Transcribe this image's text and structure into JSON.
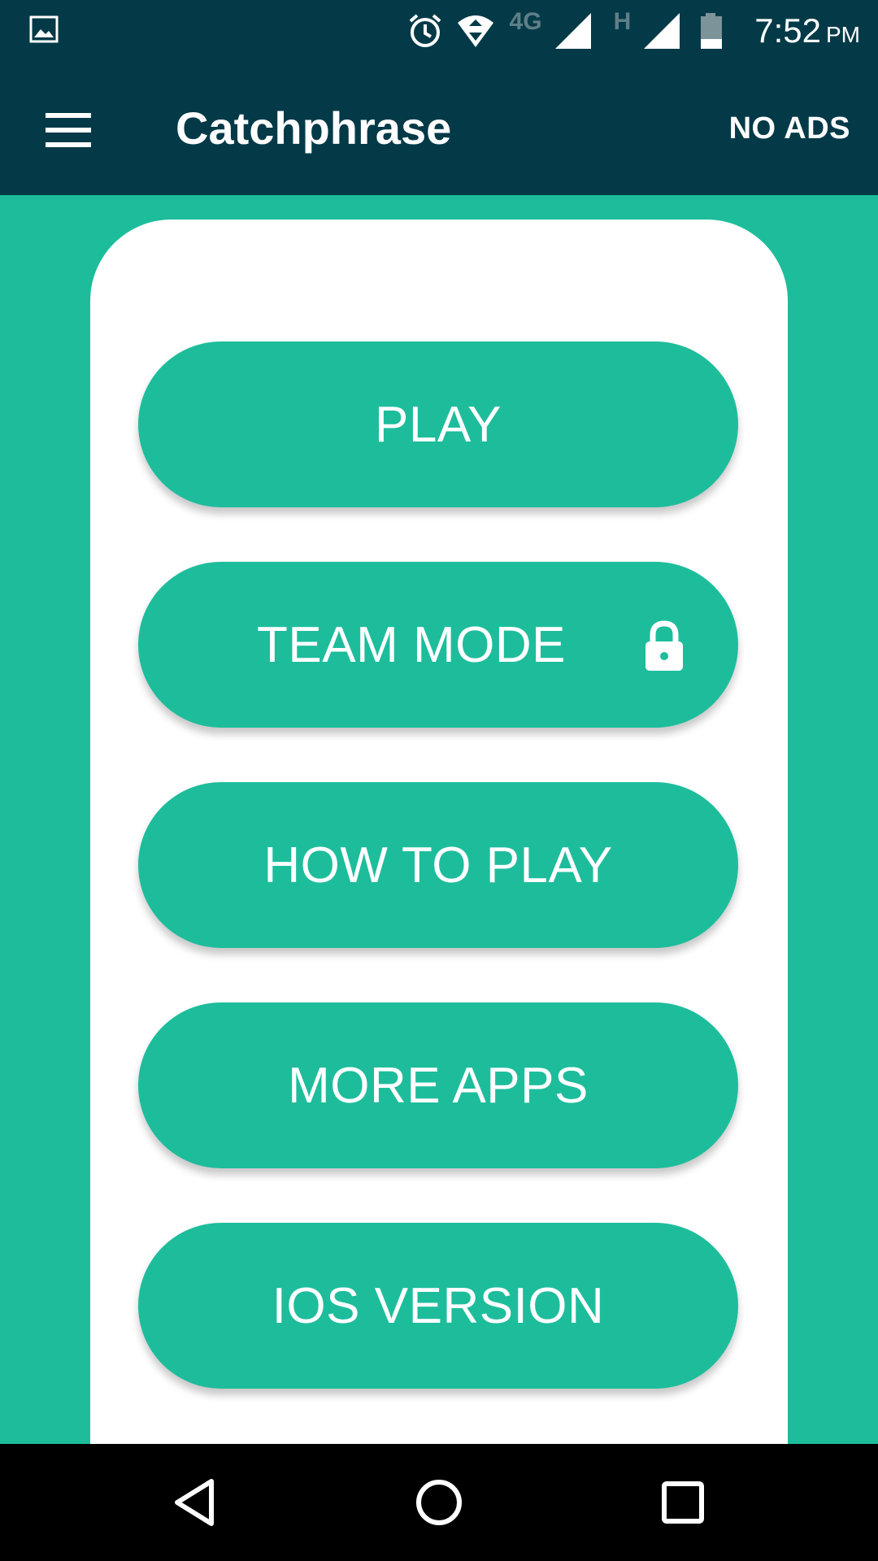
{
  "status_bar": {
    "network_label": "4G",
    "network2_label": "H",
    "time": "7:52",
    "ampm": "PM"
  },
  "app_bar": {
    "title": "Catchphrase",
    "no_ads_label": "NO ADS"
  },
  "menu": {
    "play_label": "PLAY",
    "team_mode_label": "TEAM MODE",
    "how_to_play_label": "HOW TO PLAY",
    "more_apps_label": "MORE APPS",
    "ios_version_label": "IOS VERSION"
  },
  "colors": {
    "header": "#043a48",
    "accent": "#1dbd9c",
    "card": "#ffffff"
  },
  "icons": [
    "image-icon",
    "alarm-icon",
    "wifi-icon",
    "signal-icon",
    "battery-icon",
    "hamburger-menu-icon",
    "lock-icon",
    "back-icon",
    "home-icon",
    "recents-icon"
  ]
}
